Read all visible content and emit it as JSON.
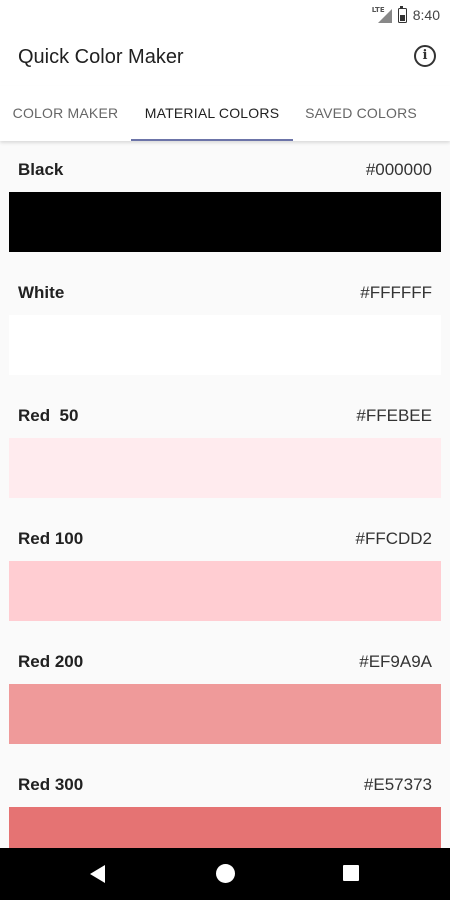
{
  "status_bar": {
    "network_label": "LTE",
    "time": "8:40"
  },
  "app_bar": {
    "title": "Quick Color Maker",
    "info_icon": "info-icon"
  },
  "tabs": [
    {
      "label": "COLOR MAKER",
      "active": false
    },
    {
      "label": "MATERIAL COLORS",
      "active": true
    },
    {
      "label": "SAVED COLORS",
      "active": false
    }
  ],
  "colors": [
    {
      "name": "Black",
      "hex": "#000000"
    },
    {
      "name": "White",
      "hex": "#FFFFFF"
    },
    {
      "name": "Red  50",
      "hex": "#FFEBEE"
    },
    {
      "name": "Red 100",
      "hex": "#FFCDD2"
    },
    {
      "name": "Red 200",
      "hex": "#EF9A9A"
    },
    {
      "name": "Red 300",
      "hex": "#E57373"
    }
  ],
  "theme": {
    "tab_indicator_color": "#6c74a8"
  },
  "nav_bar": {
    "back_icon": "back-icon",
    "home_icon": "home-icon",
    "recents_icon": "recents-icon"
  }
}
